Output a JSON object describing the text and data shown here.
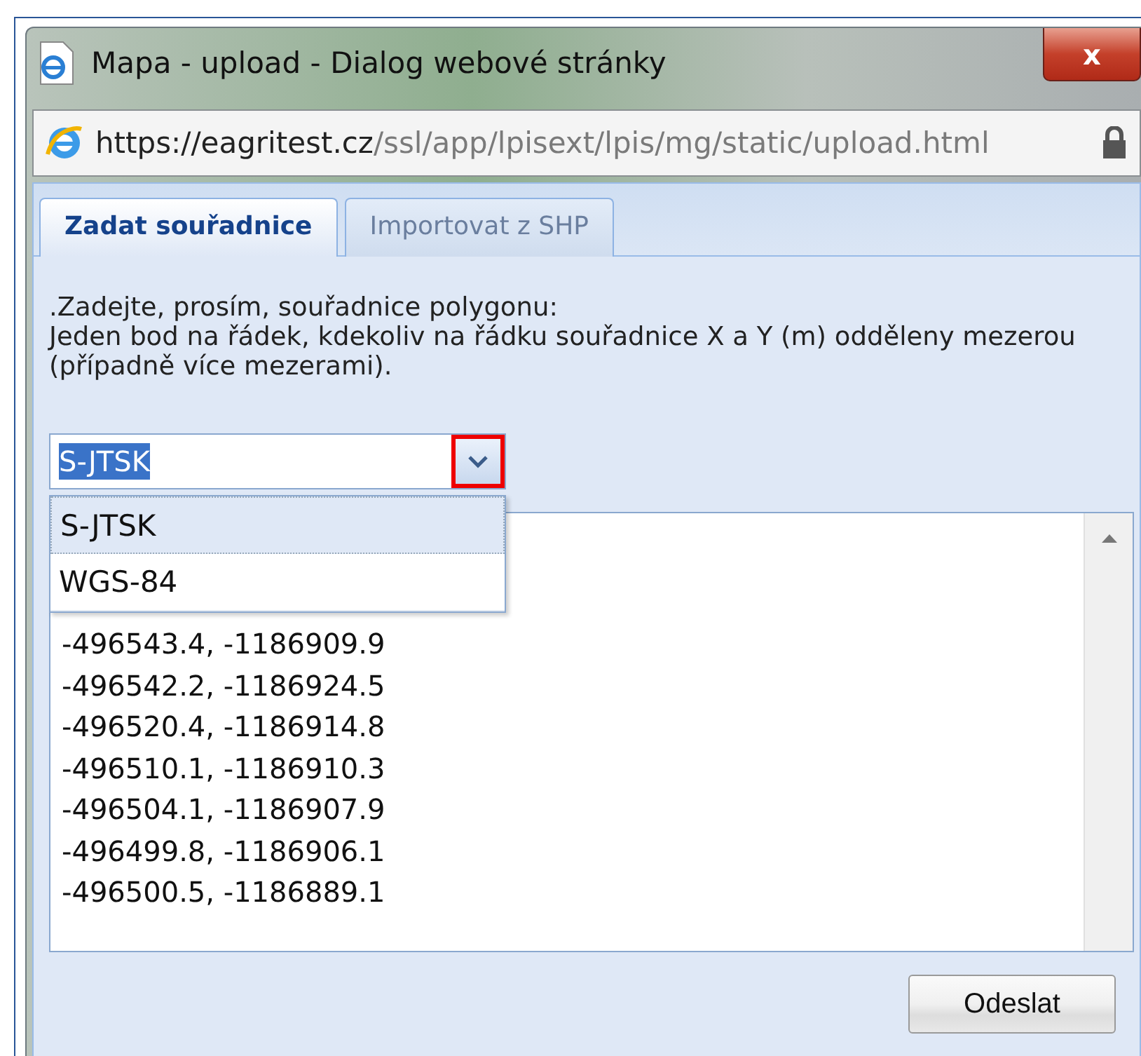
{
  "window": {
    "title": "Mapa - upload - Dialog webové stránky",
    "close": "x"
  },
  "address_bar": {
    "host": "https://eagritest.cz",
    "path": "/ssl/app/lpisext/lpis/mg/static/upload.html"
  },
  "tabs": [
    {
      "label": "Zadat souřadnice",
      "selected": true
    },
    {
      "label": "Importovat z SHP",
      "selected": false
    }
  ],
  "instructions": [
    ".Zadejte, prosím, souřadnice polygonu:",
    "Jeden bod na řádek, kdekoliv na řádku souřadnice X a Y (m) odděleny mezerou (případně více mezerami)."
  ],
  "coordinate_system": {
    "value": "S-JTSK",
    "expanded": true,
    "options": [
      {
        "label": "S-JTSK",
        "selected": true
      },
      {
        "label": "WGS-84",
        "selected": false
      }
    ]
  },
  "coordinates": [
    "-496543.4, -1186909.9",
    "-496542.2, -1186924.5",
    "-496520.4, -1186914.8",
    "-496510.1, -1186910.3",
    "-496504.1, -1186907.9",
    "-496499.8, -1186906.1",
    "-496500.5, -1186889.1"
  ],
  "submit_button": "Odeslat"
}
